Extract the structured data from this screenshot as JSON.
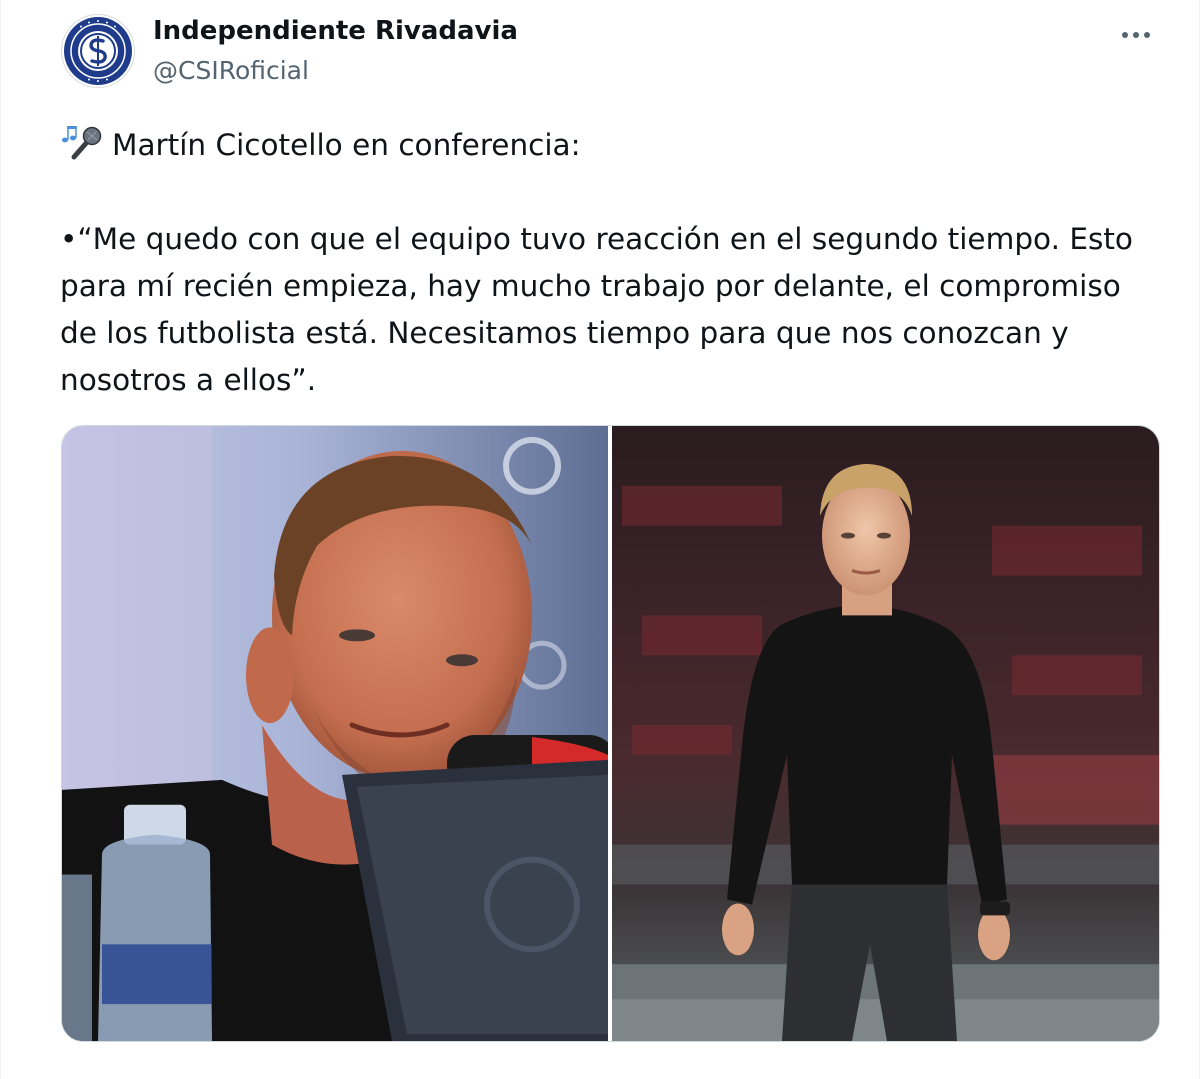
{
  "tweet": {
    "author": {
      "display_name": "Independiente Rivadavia",
      "handle": "@CSIRoficial",
      "avatar_icon": "club-crest-icon"
    },
    "more_icon": "more-dots-icon",
    "text": {
      "line1": "Martín Cicotello en conferencia:",
      "line1_icon": "microphone-emoji-icon",
      "quote_lines": [
        "•“Me quedo con que el equipo tuvo reacción en el segundo tiempo. Esto",
        "para mí recién empieza, hay mucho trabajo por delante, el compromiso",
        "de los futbolista está. Necesitamos tiempo para que nos conozcan y",
        "nosotros a ellos”."
      ]
    },
    "media": [
      {
        "name": "press-conference-photo"
      },
      {
        "name": "stadium-photo"
      }
    ]
  },
  "colors": {
    "text_primary": "#0f1419",
    "text_secondary": "#536471",
    "crest_blue": "#1f3c8c",
    "border": "#cfd9de"
  }
}
